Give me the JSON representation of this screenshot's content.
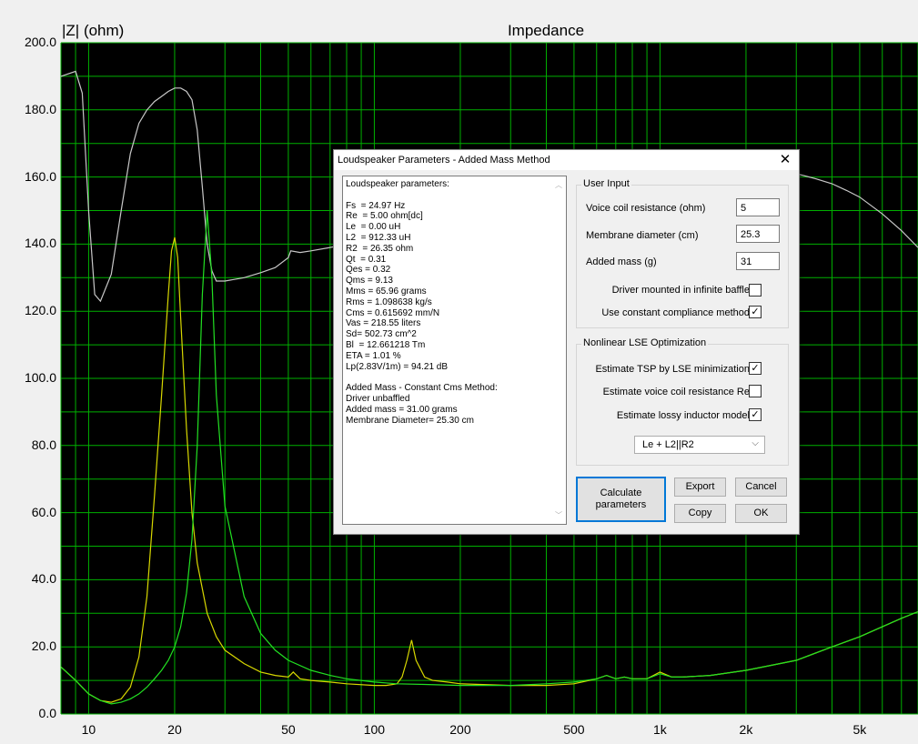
{
  "window": {
    "title": "Impedance"
  },
  "chart_data": {
    "type": "line",
    "title": "Impedance",
    "ylabel": "|Z| (ohm)",
    "xlabel": "",
    "x_scale": "log",
    "xlim": [
      8,
      8000
    ],
    "ylim": [
      0,
      200
    ],
    "yticks": [
      "200.0",
      "180.0",
      "160.0",
      "140.0",
      "120.0",
      "100.0",
      "80.0",
      "60.0",
      "40.0",
      "20.0",
      "0.0"
    ],
    "ytick_values": [
      200,
      180,
      160,
      140,
      120,
      100,
      80,
      60,
      40,
      20,
      0
    ],
    "xticks": [
      "10",
      "20",
      "50",
      "100",
      "200",
      "500",
      "1k",
      "2k",
      "5k"
    ],
    "xtick_values": [
      10,
      20,
      50,
      100,
      200,
      500,
      1000,
      2000,
      5000
    ],
    "grid": true,
    "background": "#000000",
    "grid_color": "#00b000",
    "series": [
      {
        "color": "#c8c8c8",
        "x": [
          8,
          9,
          9.5,
          10,
          10.5,
          11,
          12,
          13,
          14,
          15,
          16,
          17,
          18,
          19,
          20,
          21,
          22,
          23,
          24,
          25,
          26,
          27,
          28,
          30,
          35,
          40,
          45,
          50,
          51,
          55,
          60,
          70,
          80,
          100,
          120,
          150
        ],
        "y": [
          190,
          191.5,
          185,
          150,
          125,
          123,
          131,
          150,
          167,
          176,
          180,
          182.5,
          184,
          185.5,
          186.5,
          186.5,
          185.5,
          183,
          174,
          157,
          140,
          132,
          129,
          129,
          130,
          131.5,
          133,
          136,
          138,
          137.5,
          138,
          139,
          140,
          142,
          144,
          146
        ]
      },
      {
        "color": "#c8c8c8",
        "x": [
          2000,
          2500,
          3000,
          3500,
          4000,
          4500,
          5000,
          6000,
          7000,
          8000
        ],
        "y": [
          164,
          162.5,
          161,
          159.5,
          158,
          156,
          154,
          149,
          144,
          139
        ]
      },
      {
        "color": "#d8d800",
        "x": [
          8,
          9,
          10,
          11,
          12,
          13,
          14,
          15,
          16,
          17,
          18,
          19,
          19.5,
          20,
          20.5,
          21,
          22,
          23,
          24,
          26,
          28,
          30,
          35,
          40,
          45,
          50,
          52,
          55,
          60,
          70,
          80,
          100,
          110,
          120,
          125,
          130,
          135,
          140,
          150,
          160,
          180,
          200,
          300,
          400,
          500,
          600,
          650,
          700,
          750,
          800,
          900,
          1000,
          1100,
          1200,
          1500,
          2000,
          3000,
          4000,
          5000,
          6000,
          7000,
          8000
        ],
        "y": [
          14,
          10,
          6,
          4,
          3.5,
          4.5,
          8,
          17,
          35,
          65,
          95,
          125,
          138,
          142,
          136,
          118,
          85,
          60,
          45,
          30,
          23,
          19,
          15,
          12.5,
          11.5,
          11,
          12.5,
          10.5,
          10,
          9.5,
          9,
          8.5,
          8.5,
          9,
          11,
          16,
          22,
          16,
          11,
          10,
          9.5,
          9,
          8.5,
          8.5,
          9,
          10.5,
          11.5,
          10.5,
          11,
          10.5,
          10.5,
          12.5,
          11,
          11,
          11.5,
          13,
          16,
          20,
          23,
          26,
          28.5,
          30.5
        ]
      },
      {
        "color": "#22e022",
        "x": [
          8,
          9,
          10,
          11,
          12,
          13,
          14,
          15,
          16,
          17,
          18,
          19,
          20,
          21,
          22,
          23,
          24,
          25,
          26,
          27,
          28,
          30,
          35,
          40,
          45,
          50,
          60,
          70,
          80,
          100,
          120,
          150,
          200,
          300,
          400,
          500,
          600,
          650,
          700,
          750,
          800,
          900,
          1000,
          1100,
          1200,
          1500,
          2000,
          3000,
          4000,
          5000,
          6000,
          7000,
          8000
        ],
        "y": [
          14,
          10,
          6,
          4,
          3,
          3.5,
          4.5,
          6,
          8,
          10.5,
          13,
          16,
          20,
          26,
          36,
          52,
          80,
          125,
          150,
          130,
          95,
          62,
          35,
          24,
          19,
          16,
          13,
          11.5,
          10.5,
          9.5,
          9,
          8.8,
          8.5,
          8.5,
          9,
          9.5,
          10.5,
          11.5,
          10.5,
          11,
          10.5,
          10.5,
          12,
          11,
          11,
          11.5,
          13,
          16,
          20,
          23,
          26,
          28.5,
          30.5
        ]
      }
    ]
  },
  "dialog": {
    "title": "Loudspeaker Parameters - Added Mass Method",
    "close_glyph": "✕",
    "output_lines": [
      "Loudspeaker parameters:",
      "",
      "Fs  = 24.97 Hz",
      "Re  = 5.00 ohm[dc]",
      "Le  = 0.00 uH",
      "L2  = 912.33 uH",
      "R2  = 26.35 ohm",
      "Qt  = 0.31",
      "Qes = 0.32",
      "Qms = 9.13",
      "Mms = 65.96 grams",
      "Rms = 1.098638 kg/s",
      "Cms = 0.615692 mm/N",
      "Vas = 218.55 liters",
      "Sd= 502.73 cm^2",
      "Bl  = 12.661218 Tm",
      "ETA = 1.01 %",
      "Lp(2.83V/1m) = 94.21 dB",
      "",
      "Added Mass - Constant Cms Method:",
      "Driver unbaffled",
      "Added mass = 31.00 grams",
      "Membrane Diameter= 25.30 cm"
    ],
    "user_input": {
      "title": "User Input",
      "voice_coil_label": "Voice coil resistance (ohm)",
      "voice_coil_value": "5",
      "membrane_label": "Membrane diameter (cm)",
      "membrane_value": "25.3",
      "added_mass_label": "Added mass (g)",
      "added_mass_value": "31",
      "infinite_baffle_label": "Driver mounted in infinite baffle",
      "infinite_baffle_checked": false,
      "constant_compliance_label": "Use constant compliance method",
      "constant_compliance_checked": true
    },
    "lse": {
      "title": "Nonlinear LSE Optimization",
      "estimate_tsp_label": "Estimate TSP by LSE minimization",
      "estimate_tsp_checked": true,
      "estimate_re_label": "Estimate voice coil resistance Re",
      "estimate_re_checked": false,
      "estimate_lossy_label": "Estimate lossy inductor model",
      "estimate_lossy_checked": true,
      "model_selected": "Le + L2||R2"
    },
    "buttons": {
      "calculate": "Calculate parameters",
      "export": "Export",
      "cancel": "Cancel",
      "copy": "Copy",
      "ok": "OK"
    }
  }
}
